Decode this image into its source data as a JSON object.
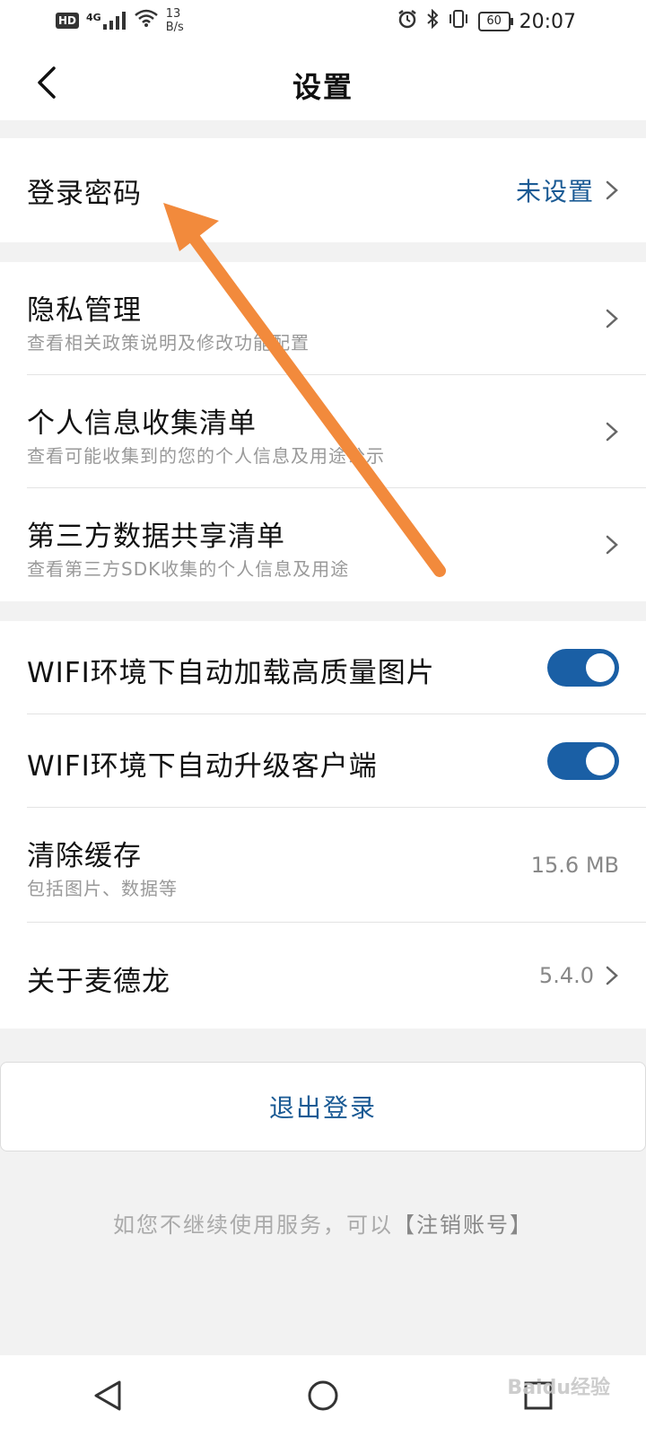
{
  "status_bar": {
    "hd": "HD",
    "network": "4G",
    "speed_value": "13",
    "speed_unit": "B/s",
    "battery": "60",
    "time": "20:07"
  },
  "header": {
    "title": "设置"
  },
  "login_password": {
    "label": "登录密码",
    "value": "未设置"
  },
  "privacy_section": [
    {
      "title": "隐私管理",
      "subtitle": "查看相关政策说明及修改功能配置"
    },
    {
      "title": "个人信息收集清单",
      "subtitle": "查看可能收集到的您的个人信息及用途公示"
    },
    {
      "title": "第三方数据共享清单",
      "subtitle": "查看第三方SDK收集的个人信息及用途"
    }
  ],
  "general_section": {
    "wifi_images": {
      "title": "WIFI环境下自动加载高质量图片",
      "enabled": true
    },
    "wifi_upgrade": {
      "title": "WIFI环境下自动升级客户端",
      "enabled": true
    },
    "clear_cache": {
      "title": "清除缓存",
      "subtitle": "包括图片、数据等",
      "value": "15.6 MB"
    },
    "about": {
      "title": "关于麦德龙",
      "value": "5.4.0"
    }
  },
  "logout_label": "退出登录",
  "footer": {
    "note": "如您不继续使用服务，可以",
    "link": "【注销账号】"
  },
  "watermark": "Baidu经验",
  "colors": {
    "accent": "#1a5a94",
    "toggle_on": "#1a5fa5",
    "arrow": "#f28a3c"
  }
}
